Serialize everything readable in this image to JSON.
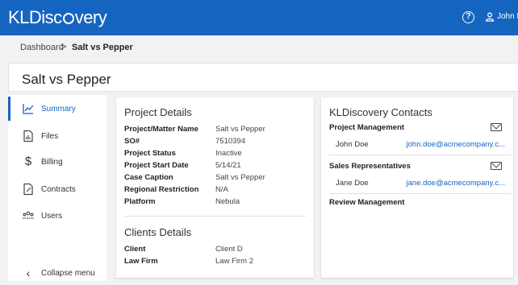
{
  "header": {
    "logo_text": "KLDiscovery",
    "help_icon": "help-circle-icon",
    "user_icon": "user-icon",
    "user_name": "John Doe",
    "brand_color": "#1565c0"
  },
  "breadcrumb": {
    "root": "Dashboard",
    "separator": ">",
    "current": "Salt vs Pepper"
  },
  "page": {
    "title": "Salt vs Pepper"
  },
  "sidebar": {
    "items": [
      {
        "label": "Summary",
        "icon": "chart-line-icon",
        "active": true
      },
      {
        "label": "Files",
        "icon": "file-chart-icon",
        "active": false
      },
      {
        "label": "Billing",
        "icon": "dollar-icon",
        "active": false
      },
      {
        "label": "Contracts",
        "icon": "contract-icon",
        "active": false
      },
      {
        "label": "Users",
        "icon": "users-icon",
        "active": false
      }
    ],
    "collapse_label": "Collapse menu",
    "collapse_icon": "chevron-left-icon"
  },
  "project_details": {
    "title": "Project Details",
    "rows": [
      {
        "label": "Project/Matter Name",
        "value": "Salt vs Pepper"
      },
      {
        "label": "SO#",
        "value": "7510394"
      },
      {
        "label": "Project Status",
        "value": "Inactive"
      },
      {
        "label": "Project Start Date",
        "value": "5/14/21"
      },
      {
        "label": "Case Caption",
        "value": "Salt vs Pepper"
      },
      {
        "label": "Regional Restriction",
        "value": "N/A"
      },
      {
        "label": "Platform",
        "value": "Nebula"
      }
    ]
  },
  "client_details": {
    "title": "Clients Details",
    "rows": [
      {
        "label": "Client",
        "value": "Client D"
      },
      {
        "label": "Law Firm",
        "value": "Law Firm 2"
      }
    ]
  },
  "contacts": {
    "title": "KLDiscovery Contacts",
    "sections": [
      {
        "title": "Project Management",
        "contacts": [
          {
            "name": "John Doe",
            "email": "john.doe@acmecompany.c..."
          }
        ]
      },
      {
        "title": "Sales Representatives",
        "contacts": [
          {
            "name": "Jane Doe",
            "email": "jane.doe@acmecompany.c..."
          }
        ]
      },
      {
        "title": "Review Management",
        "contacts": []
      }
    ]
  }
}
